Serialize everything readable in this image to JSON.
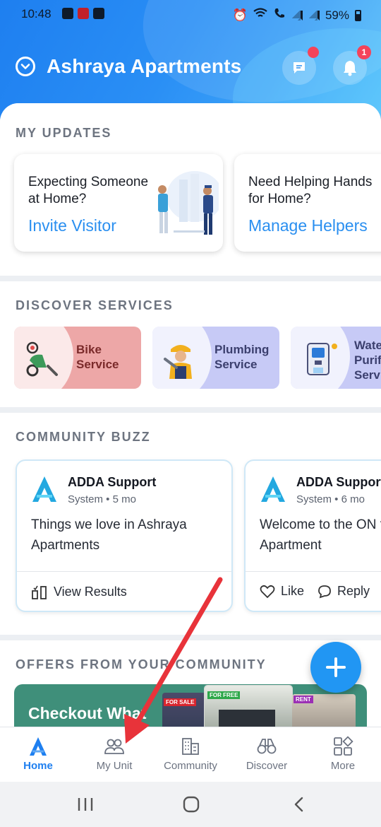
{
  "status": {
    "time": "10:48",
    "battery": "59%"
  },
  "header": {
    "title": "Ashraya Apartments",
    "notification_count": "1"
  },
  "updates": {
    "section_title": "MY UPDATES",
    "cards": [
      {
        "text": "Expecting Someone at Home?",
        "action": "Invite Visitor"
      },
      {
        "text": "Need Helping Hands for Home?",
        "action": "Manage Helpers"
      }
    ]
  },
  "services": {
    "section_title": "DISCOVER SERVICES",
    "items": [
      {
        "label_line1": "Bike",
        "label_line2": "Service",
        "bg": "#eda7a7",
        "text_color": "#7a2a2a"
      },
      {
        "label_line1": "Plumbing",
        "label_line2": "Service",
        "bg": "#c7caf6",
        "text_color": "#3b3f6e"
      },
      {
        "label_line1": "Wate",
        "label_line2": "Purifi",
        "label_line3": "Servi",
        "bg": "#c7caf6",
        "text_color": "#3b3f6e"
      }
    ]
  },
  "buzz": {
    "section_title": "COMMUNITY BUZZ",
    "posts": [
      {
        "author": "ADDA Support",
        "meta": "System • 5 mo",
        "body": "Things we love in Ashraya Apartments",
        "footer": "View Results"
      },
      {
        "author": "ADDA Support",
        "meta": "System • 6 mo",
        "body": "Welcome to the ON for your Apartment",
        "like": "Like",
        "reply": "Reply"
      }
    ]
  },
  "offers": {
    "section_title": "OFFERS FROM YOUR COMMUNITY",
    "banner_title": "Checkout What",
    "tags": [
      "FOR SALE",
      "FOR FREE",
      "RENT"
    ]
  },
  "bottom_nav": {
    "items": [
      {
        "label": "Home",
        "icon": "adda-logo-icon",
        "active": true
      },
      {
        "label": "My Unit",
        "icon": "people-icon"
      },
      {
        "label": "Community",
        "icon": "buildings-icon"
      },
      {
        "label": "Discover",
        "icon": "binoculars-icon"
      },
      {
        "label": "More",
        "icon": "grid-icon"
      }
    ]
  },
  "colors": {
    "accent": "#2a8ff0",
    "annotation_arrow": "#e8333a"
  }
}
